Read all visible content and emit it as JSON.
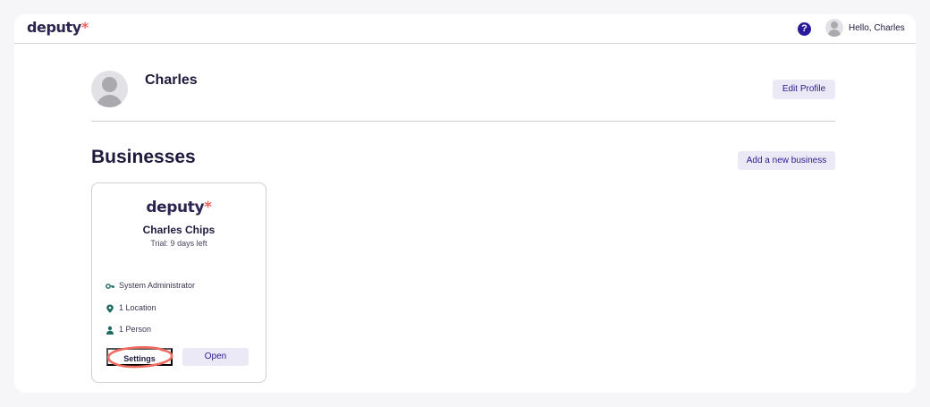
{
  "header": {
    "logo_text": "deputy",
    "logo_mark": "*",
    "help_icon": "?",
    "greeting": "Hello, Charles"
  },
  "profile": {
    "name": "Charles",
    "edit_label": "Edit Profile"
  },
  "businesses": {
    "title": "Businesses",
    "add_label": "Add a new business",
    "cards": [
      {
        "logo_text": "deputy",
        "logo_mark": "*",
        "name": "Charles Chips",
        "trial": "Trial: 9 days left",
        "role": "System Administrator",
        "locations": "1 Location",
        "people": "1 Person",
        "settings_label": "Settings",
        "open_label": "Open"
      }
    ]
  },
  "colors": {
    "brand": "#2a2450",
    "accent": "#f2665b",
    "button_bg": "#ece9f7",
    "button_text": "#2a1a8e",
    "icon_teal": "#1d6b63",
    "annotation": "#ee6b60"
  }
}
